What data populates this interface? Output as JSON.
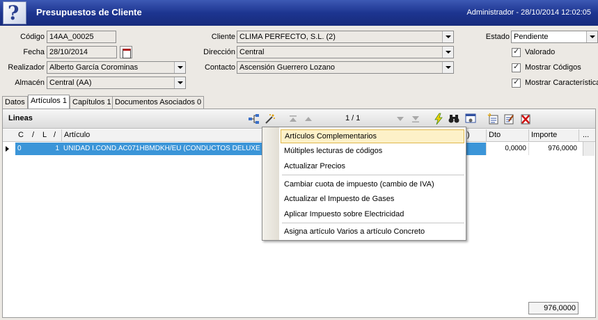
{
  "window": {
    "title": "Presupuestos de Cliente",
    "user_date": "Administrador - 28/10/2014 12:02:05"
  },
  "form": {
    "codigo": {
      "label": "Código",
      "value": "14AA_00025"
    },
    "fecha": {
      "label": "Fecha",
      "value": "28/10/2014"
    },
    "realizador": {
      "label": "Realizador",
      "value": "Alberto García Corominas"
    },
    "almacen": {
      "label": "Almacén",
      "value": "Central (AA)"
    },
    "cliente": {
      "label": "Cliente",
      "value": "CLIMA PERFECTO, S.L. (2)"
    },
    "direccion": {
      "label": "Dirección",
      "value": "Central"
    },
    "contacto": {
      "label": "Contacto",
      "value": "Ascensión Guerrero Lozano"
    },
    "estado": {
      "label": "Estado",
      "value": "Pendiente"
    },
    "checks": [
      {
        "label": "Valorado",
        "checked": true
      },
      {
        "label": "Mostrar Códigos",
        "checked": true
      },
      {
        "label": "Mostrar Características",
        "checked": true
      }
    ]
  },
  "tabs": [
    {
      "label": "Datos"
    },
    {
      "label": "Artículos 1"
    },
    {
      "label": "Capítulos 1"
    },
    {
      "label": "Documentos Asociados 0"
    }
  ],
  "lines": {
    "title": "Lineas",
    "pager": "1 / 1",
    "columns": {
      "c": "C",
      "slash1": "/",
      "l": "L",
      "slash2": "/",
      "articulo": "Artículo",
      "paren": ")",
      "dto": "Dto",
      "importe": "Importe",
      "more": "..."
    },
    "rows": [
      {
        "c": "0",
        "l": "1",
        "articulo": "UNIDAD I.COND.AC071HBMDKH/EU  (CONDUCTOS DELUXE",
        "dto": "0,0000",
        "importe": "976,0000"
      }
    ],
    "total": "976,0000"
  },
  "context_menu": {
    "items": [
      "Artículos Complementarios",
      "Múltiples lecturas de códigos",
      "Actualizar Precios",
      "Cambiar cuota de impuesto (cambio de IVA)",
      "Actualizar el Impuesto de Gases",
      "Aplicar Impuesto sobre Electricidad",
      "Asigna artículo Varios a artículo Concreto"
    ],
    "highlighted_index": 0
  },
  "colors": {
    "titlebar": "#1d3590",
    "selection": "#3b95d8",
    "menu_highlight": "#fdf1c8"
  }
}
